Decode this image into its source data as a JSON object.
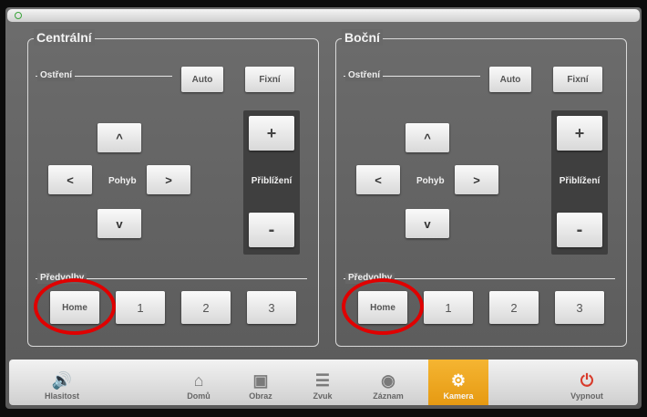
{
  "panels": [
    {
      "title": "Centrální",
      "focus_label": "Ostření",
      "auto_label": "Auto",
      "fixed_label": "Fixní",
      "move_label": "Pohyb",
      "zoom_label": "Přiblížení",
      "zoom_in": "+",
      "zoom_out": "-",
      "presets_label": "Předvolby",
      "presets": [
        "Home",
        "1",
        "2",
        "3"
      ]
    },
    {
      "title": "Boční",
      "focus_label": "Ostření",
      "auto_label": "Auto",
      "fixed_label": "Fixní",
      "move_label": "Pohyb",
      "zoom_label": "Přiblížení",
      "zoom_in": "+",
      "zoom_out": "-",
      "presets_label": "Předvolby",
      "presets": [
        "Home",
        "1",
        "2",
        "3"
      ]
    }
  ],
  "arrows": {
    "up": "^",
    "down": "v",
    "left": "<",
    "right": ">"
  },
  "dock": [
    {
      "label": "Hlasitost",
      "icon": "speaker-icon"
    },
    {
      "label": "Domů",
      "icon": "home-icon"
    },
    {
      "label": "Obraz",
      "icon": "display-icon"
    },
    {
      "label": "Zvuk",
      "icon": "mixer-icon"
    },
    {
      "label": "Záznam",
      "icon": "recorder-icon"
    },
    {
      "label": "Kamera",
      "icon": "camera-icon",
      "active": true
    },
    {
      "label": "Vypnout",
      "icon": "power-icon"
    }
  ],
  "colors": {
    "accent_active": "#f0a820",
    "annotation": "#e00000",
    "power": "#d83a2a"
  }
}
